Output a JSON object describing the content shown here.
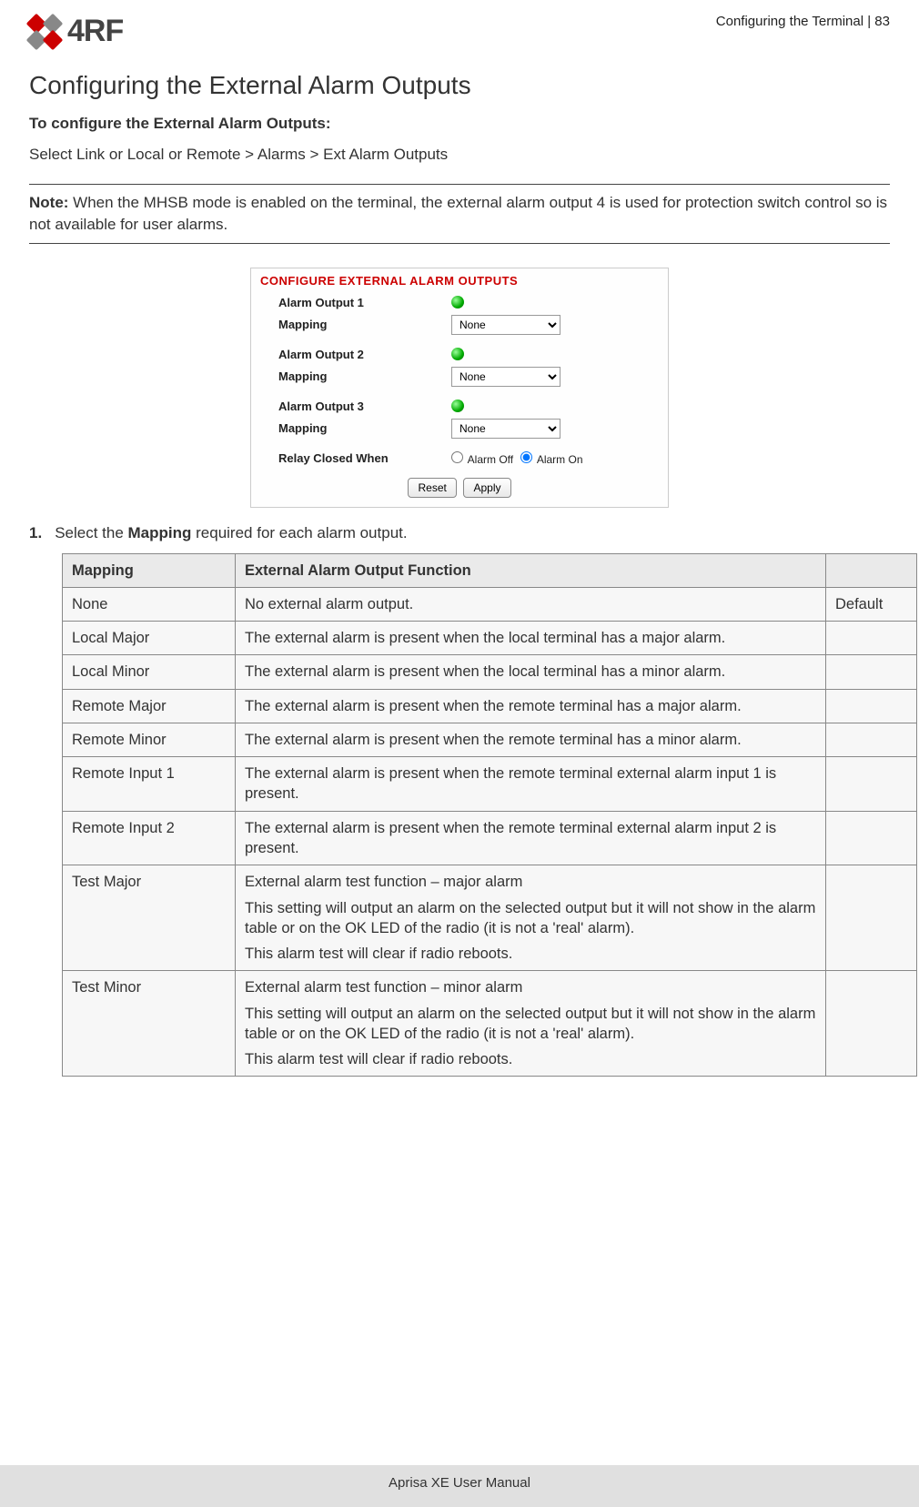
{
  "header": {
    "logo_text": "4RF",
    "page_ref": "Configuring the Terminal  |  83"
  },
  "title": "Configuring the External Alarm Outputs",
  "subhead": "To configure the External Alarm Outputs:",
  "breadcrumb": "Select Link or Local or Remote > Alarms > Ext Alarm Outputs",
  "note": {
    "label": "Note:",
    "text": " When the MHSB mode is enabled on the terminal, the external alarm output 4 is used for protection switch control so is not available for user alarms."
  },
  "panel": {
    "title": "CONFIGURE EXTERNAL ALARM OUTPUTS",
    "rows": [
      {
        "label": "Alarm Output 1",
        "type": "status"
      },
      {
        "label": "Mapping",
        "type": "select",
        "value": "None"
      },
      {
        "label": "Alarm Output 2",
        "type": "status"
      },
      {
        "label": "Mapping",
        "type": "select",
        "value": "None"
      },
      {
        "label": "Alarm Output 3",
        "type": "status"
      },
      {
        "label": "Mapping",
        "type": "select",
        "value": "None"
      }
    ],
    "relay_label": "Relay Closed When",
    "relay_opt_off": "Alarm Off",
    "relay_opt_on": "Alarm On",
    "reset_btn": "Reset",
    "apply_btn": "Apply"
  },
  "step": {
    "num": "1.",
    "pre": "Select the ",
    "bold": "Mapping",
    "post": " required for each alarm output."
  },
  "table": {
    "hdr_mapping": "Mapping",
    "hdr_func": "External Alarm Output Function",
    "hdr_def": "",
    "rows": [
      {
        "m": "None",
        "f": [
          "No external alarm output."
        ],
        "d": "Default"
      },
      {
        "m": "Local Major",
        "f": [
          "The external alarm is present when the local terminal has a major alarm."
        ],
        "d": ""
      },
      {
        "m": "Local Minor",
        "f": [
          "The external alarm is present when the local terminal has a minor alarm."
        ],
        "d": ""
      },
      {
        "m": "Remote Major",
        "f": [
          "The external alarm is present when the remote terminal has a major alarm."
        ],
        "d": ""
      },
      {
        "m": "Remote Minor",
        "f": [
          "The external alarm is present when the remote terminal has a minor alarm."
        ],
        "d": ""
      },
      {
        "m": "Remote Input 1",
        "f": [
          "The external alarm is present when the remote terminal external alarm input 1 is present."
        ],
        "d": ""
      },
      {
        "m": "Remote Input 2",
        "f": [
          "The external alarm is present when the remote terminal external alarm input 2 is present."
        ],
        "d": ""
      },
      {
        "m": "Test Major",
        "f": [
          "External alarm test function – major alarm",
          "This setting will output an alarm on the selected output but it will not show in the alarm table or on the OK LED of the radio (it is not a 'real' alarm).",
          "This alarm test will clear if radio reboots."
        ],
        "d": ""
      },
      {
        "m": "Test Minor",
        "f": [
          "External alarm test function – minor alarm",
          "This setting will output an alarm on the selected output but it will not show in the alarm table or on the OK LED of the radio (it is not a 'real' alarm).",
          "This alarm test will clear if radio reboots."
        ],
        "d": ""
      }
    ]
  },
  "footer": "Aprisa XE User Manual"
}
